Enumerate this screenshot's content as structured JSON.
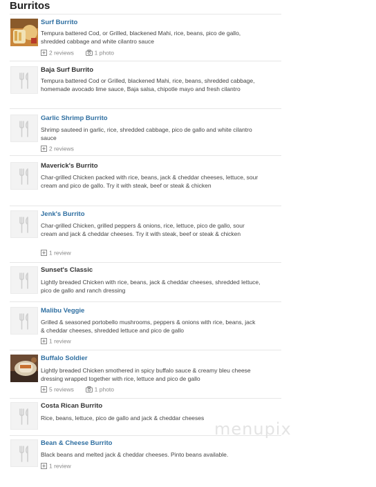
{
  "section": {
    "title": "Burritos"
  },
  "items": [
    {
      "name": "Surf Burrito",
      "desc": "Tempura battered Cod, or Grilled, blackened Mahi, rice, beans, pico de gallo, shredded cabbage and white cilantro sauce",
      "reviews": "2 reviews",
      "photos": "1 photo",
      "thumb": "photo-fries-burrito"
    },
    {
      "name": "Baja Surf Burrito",
      "desc": "Tempura battered Cod or Grilled, blackened Mahi, rice, beans, shredded cabbage, homemade avocado lime sauce, Baja salsa, chipotle mayo and fresh cilantro",
      "thumb": "utensils-placeholder-icon"
    },
    {
      "name": "Garlic Shrimp Burrito",
      "desc": "Shrimp sauteed in garlic, rice, shredded cabbage, pico de gallo and white cilantro sauce",
      "reviews": "2 reviews",
      "thumb": "utensils-placeholder-icon"
    },
    {
      "name": "Maverick's Burrito",
      "desc": "Char-grilled Chicken packed with rice, beans, jack & cheddar cheeses, lettuce, sour cream and pico de gallo. Try it with steak, beef or steak & chicken",
      "thumb": "utensils-placeholder-icon"
    },
    {
      "name": "Jenk's Burrito",
      "desc": "Char-grilled Chicken, grilled peppers & onions, rice, lettuce, pico de gallo, sour cream and jack & cheddar cheeses. Try it with steak, beef or steak & chicken",
      "reviews": "1 review",
      "thumb": "utensils-placeholder-icon"
    },
    {
      "name": "Sunset's Classic",
      "desc": "Lightly breaded Chicken with rice, beans, jack & cheddar cheeses, shredded lettuce, pico de gallo and ranch dressing",
      "thumb": "utensils-placeholder-icon"
    },
    {
      "name": "Malibu Veggie",
      "desc": "Grilled & seasoned portobello mushrooms, peppers & onions with rice, beans, jack & cheddar cheeses, shredded lettuce and pico de gallo",
      "reviews": "1 review",
      "thumb": "utensils-placeholder-icon"
    },
    {
      "name": "Buffalo Soldier",
      "desc": "Lightly breaded Chicken smothered in spicy buffalo sauce & creamy bleu cheese dressing wrapped together with rice, lettuce and pico de gallo",
      "reviews": "5 reviews",
      "photos": "1 photo",
      "thumb": "photo-buffalo-burrito"
    },
    {
      "name": "Costa Rican Burrito",
      "desc": "Rice, beans, lettuce, pico de gallo and jack & cheddar cheeses",
      "thumb": "utensils-placeholder-icon"
    },
    {
      "name": "Bean & Cheese Burrito",
      "desc": "Black beans and melted jack & cheddar cheeses. Pinto beans available.",
      "reviews": "1 review",
      "thumb": "utensils-placeholder-icon"
    }
  ],
  "watermark": "menupix",
  "colors": {
    "link": "#2f6fa1",
    "plain_name": "#333333",
    "meta": "#8a8a8a",
    "rule": "#e6e6e6"
  }
}
